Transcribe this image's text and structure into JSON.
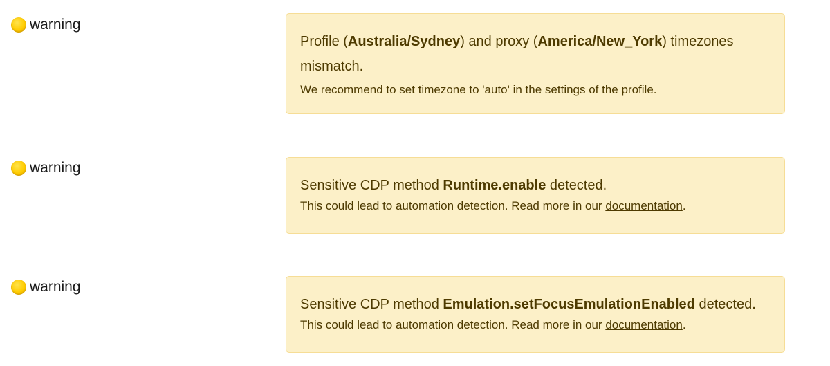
{
  "colors": {
    "alert_background": "#fcf0c8",
    "alert_border": "#f6dd96",
    "alert_text": "#4d3a00",
    "status_dot": "#ffcc00",
    "divider": "#dcdcdc"
  },
  "rows": [
    {
      "status_icon": "yellow-circle-icon",
      "status_label": "warning",
      "title_parts": [
        "Profile (",
        "Australia/Sydney",
        ") and proxy (",
        "America/New_York",
        ") timezones mismatch."
      ],
      "hint": "We recommend to set timezone to 'auto' in the settings of the profile."
    },
    {
      "status_icon": "yellow-circle-icon",
      "status_label": "warning",
      "title_parts": [
        "Sensitive CDP method ",
        "Runtime.enable",
        " detected."
      ],
      "hint_prefix": "This could lead to automation detection. Read more in our ",
      "hint_link": "documentation",
      "hint_suffix": "."
    },
    {
      "status_icon": "yellow-circle-icon",
      "status_label": "warning",
      "title_parts": [
        "Sensitive CDP method ",
        "Emulation.setFocusEmulationEnabled",
        " detected."
      ],
      "hint_prefix": "This could lead to automation detection. Read more in our ",
      "hint_link": "documentation",
      "hint_suffix": "."
    }
  ]
}
